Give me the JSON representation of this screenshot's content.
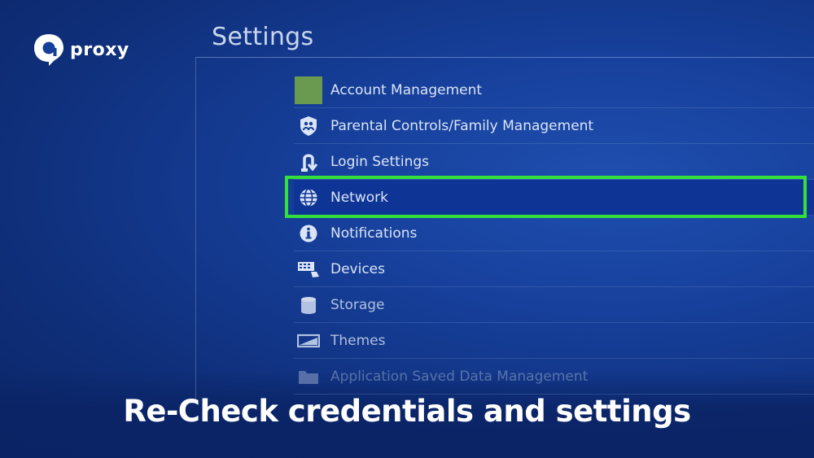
{
  "brand": {
    "logo_text": "proxy",
    "logo_icon": "proxy-logo-icon"
  },
  "screen": {
    "title": "Settings"
  },
  "menu": {
    "items": [
      {
        "label": "Account Management",
        "icon": "account-square-icon"
      },
      {
        "label": "Parental Controls/Family Management",
        "icon": "family-shield-icon"
      },
      {
        "label": "Login Settings",
        "icon": "login-arrow-icon"
      },
      {
        "label": "Network",
        "icon": "globe-icon",
        "selected": true
      },
      {
        "label": "Notifications",
        "icon": "info-icon"
      },
      {
        "label": "Devices",
        "icon": "keyboard-icon"
      },
      {
        "label": "Storage",
        "icon": "storage-cylinder-icon"
      },
      {
        "label": "Themes",
        "icon": "themes-icon"
      },
      {
        "label": "Application Saved Data Management",
        "icon": "folder-icon"
      }
    ]
  },
  "caption": {
    "text": "Re-Check credentials and settings"
  },
  "colors": {
    "background": "#163f9a",
    "highlight": "#35e03a",
    "account_square": "#6a9a4f",
    "text": "#dbe4f4"
  }
}
